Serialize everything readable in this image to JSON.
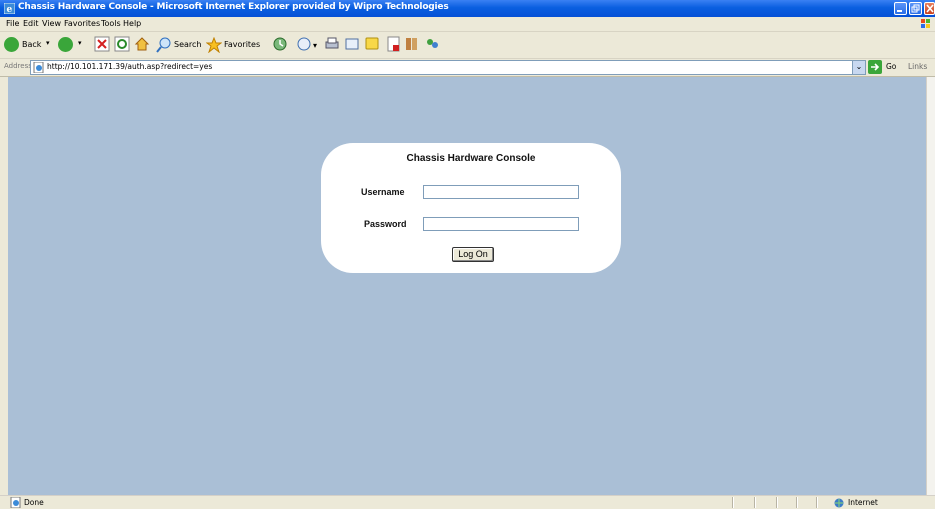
{
  "window": {
    "title": "Chassis Hardware Console - Microsoft Internet Explorer provided by Wipro Technologies"
  },
  "menu": [
    "File",
    "Edit",
    "View",
    "Favorites",
    "Tools",
    "Help"
  ],
  "toolbar": {
    "back_label": "Back",
    "search_label": "Search",
    "favorites_label": "Favorites"
  },
  "address": {
    "label": "Address",
    "url": "http://10.101.171.39/auth.asp?redirect=yes",
    "go_label": "Go",
    "links_label": "Links"
  },
  "login": {
    "title": "Chassis Hardware Console",
    "username_label": "Username",
    "password_label": "Password",
    "username_value": "",
    "password_value": "",
    "submit_label": "Log On"
  },
  "status": {
    "text": "Done",
    "zone": "Internet"
  },
  "colors": {
    "content_bg": "#aabfd6",
    "titlebar": "#0a5fe0"
  }
}
